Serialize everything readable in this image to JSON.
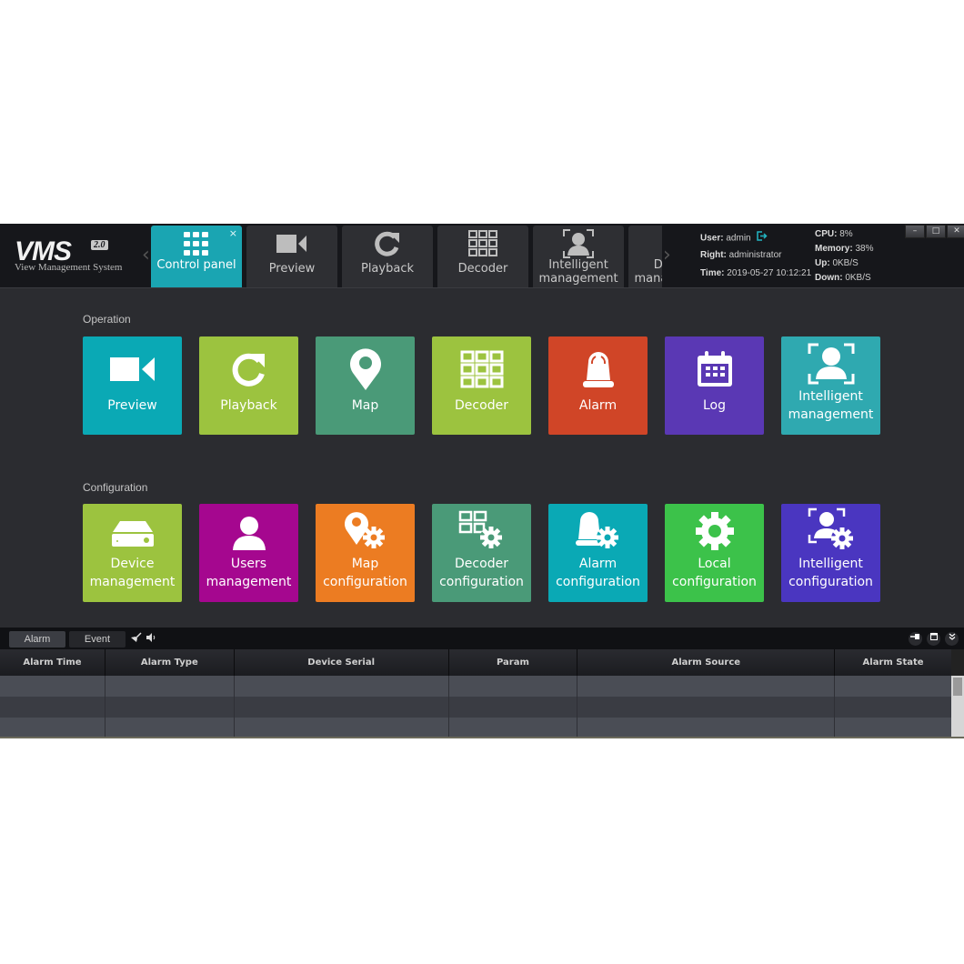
{
  "app": {
    "logo": {
      "title": "VMS",
      "version": "2.0",
      "subtitle": "View Management System"
    }
  },
  "tabs": [
    {
      "label": "Control panel",
      "icon": "grid-icon",
      "active": true,
      "closable": true,
      "close_glyph": "×"
    },
    {
      "label": "Preview",
      "icon": "video-camera-icon",
      "active": false
    },
    {
      "label": "Playback",
      "icon": "refresh-icon",
      "active": false
    },
    {
      "label": "Decoder",
      "icon": "decoder-grid-icon",
      "active": false
    },
    {
      "label": "Intelligent management",
      "icon": "face-recognition-icon",
      "active": false
    },
    {
      "label": "Device management",
      "icon": "device-icon",
      "active": false
    }
  ],
  "tab_nav": {
    "prev_glyph": "‹",
    "next_glyph": "›"
  },
  "status": {
    "user_label": "User:",
    "user": "admin",
    "right_label": "Right:",
    "right": "administrator",
    "time_label": "Time:",
    "time": "2019-05-27 10:12:21",
    "cpu_label": "CPU:",
    "cpu": "8%",
    "memory_label": "Memory:",
    "memory": "38%",
    "up_label": "Up:",
    "up": "0KB/S",
    "down_label": "Down:",
    "down": "0KB/S"
  },
  "window_controls": {
    "minimize": "–",
    "maximize": "□",
    "close": "✕"
  },
  "operation": {
    "title": "Operation",
    "tiles": [
      {
        "label": "Preview",
        "icon": "video-camera-icon",
        "color": "#0aa9b5"
      },
      {
        "label": "Playback",
        "icon": "refresh-icon",
        "color": "#9cc33f"
      },
      {
        "label": "Map",
        "icon": "map-pin-icon",
        "color": "#4a9a78"
      },
      {
        "label": "Decoder",
        "icon": "decoder-grid-icon",
        "color": "#9cc33f"
      },
      {
        "label": "Alarm",
        "icon": "alarm-bell-icon",
        "color": "#d04527"
      },
      {
        "label": "Log",
        "icon": "calendar-icon",
        "color": "#5a38b4"
      },
      {
        "label": "Intelligent management",
        "icon": "face-recognition-icon",
        "color": "#2fa9b0"
      }
    ]
  },
  "configuration": {
    "title": "Configuration",
    "tiles": [
      {
        "label": "Device management",
        "icon": "device-icon",
        "color": "#9cc33f"
      },
      {
        "label": "Users management",
        "icon": "user-icon",
        "color": "#a5078f"
      },
      {
        "label": "Map configuration",
        "icon": "map-gear-icon",
        "color": "#ec7c22"
      },
      {
        "label": "Decoder configuration",
        "icon": "decoder-gear-icon",
        "color": "#4a9a78"
      },
      {
        "label": "Alarm configuration",
        "icon": "alarm-gear-icon",
        "color": "#0aa9b5"
      },
      {
        "label": "Local configuration",
        "icon": "gear-icon",
        "color": "#3cc24a"
      },
      {
        "label": "Intelligent configuration",
        "icon": "face-gear-icon",
        "color": "#4a36c0"
      }
    ]
  },
  "alarm_panel": {
    "tabs": [
      {
        "label": "Alarm",
        "active": true
      },
      {
        "label": "Event",
        "active": false
      }
    ],
    "tools": [
      "clear-icon",
      "sound-icon"
    ],
    "columns": [
      "Alarm Time",
      "Alarm Type",
      "Device Serial",
      "Param",
      "Alarm Source",
      "Alarm State"
    ],
    "rows": [
      [
        "",
        "",
        "",
        "",
        "",
        ""
      ],
      [
        "",
        "",
        "",
        "",
        "",
        ""
      ],
      [
        "",
        "",
        "",
        "",
        "",
        ""
      ]
    ],
    "right_buttons": [
      "pin-icon",
      "restore-icon",
      "collapse-icon"
    ]
  }
}
